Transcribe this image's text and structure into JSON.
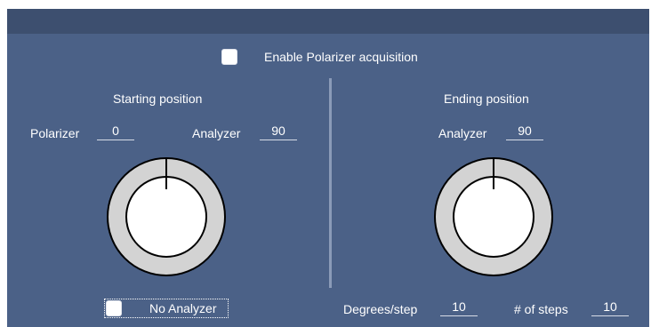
{
  "enable_polarizer": {
    "label": "Enable Polarizer acquisition",
    "checked": false
  },
  "starting": {
    "heading": "Starting position",
    "polarizer": {
      "label": "Polarizer",
      "value": "0"
    },
    "analyzer": {
      "label": "Analyzer",
      "value": "90"
    }
  },
  "ending": {
    "heading": "Ending position",
    "analyzer": {
      "label": "Analyzer",
      "value": "90"
    }
  },
  "no_analyzer": {
    "label": "No Analyzer",
    "checked": false
  },
  "degrees_step": {
    "label": "Degrees/step",
    "value": "10"
  },
  "num_steps": {
    "label": "# of steps",
    "value": "10"
  },
  "colors": {
    "panel_bg": "#4b6187",
    "topbar_bg": "#3d4f6f",
    "knob_ring": "#d3d3d3",
    "knob_center": "#ffffff",
    "text": "#ffffff"
  }
}
